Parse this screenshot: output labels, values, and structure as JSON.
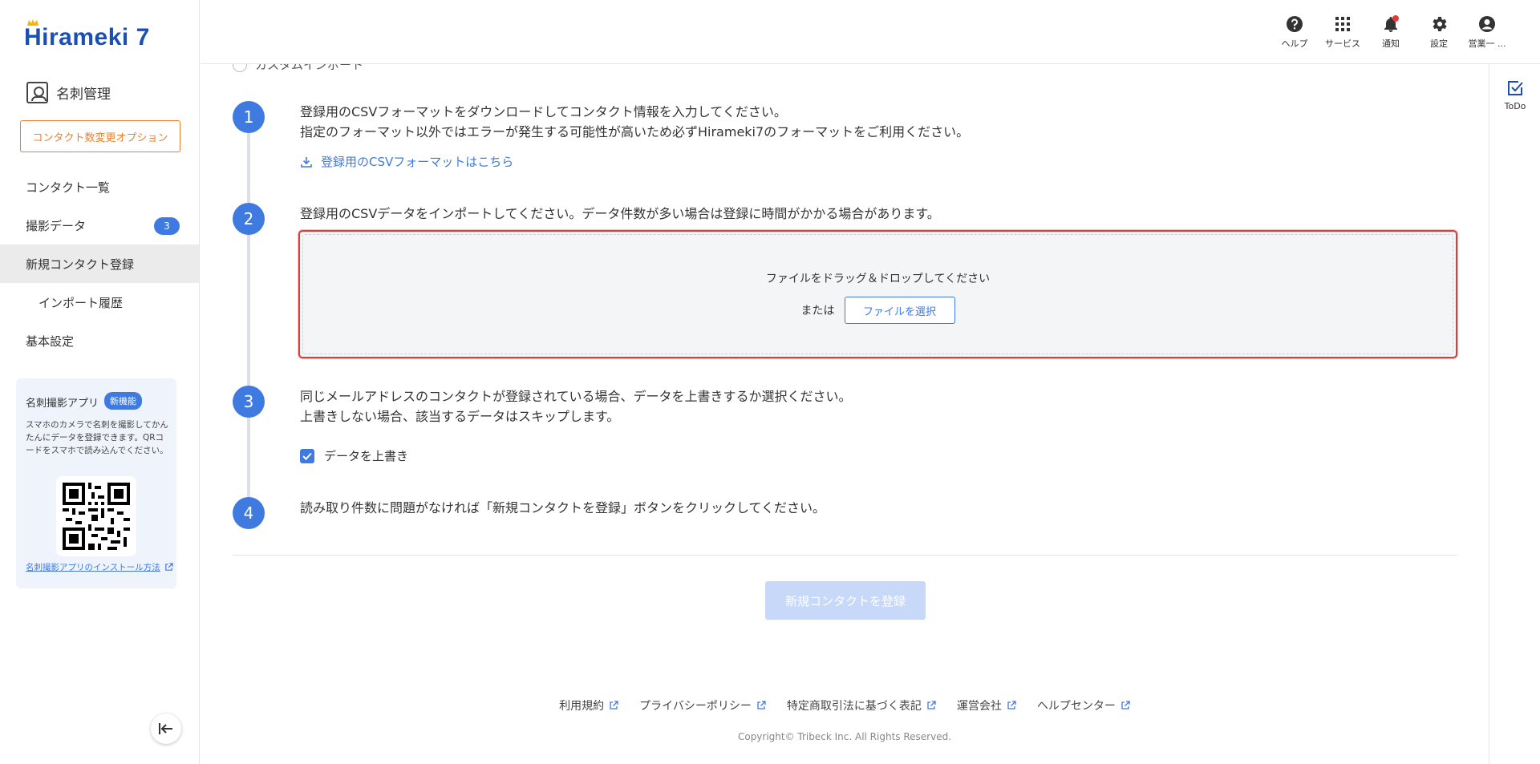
{
  "brand": {
    "logo_text": "Hirameki 7"
  },
  "sidebar": {
    "section_title": "名刺管理",
    "option_button": "コンタクト数変更オプション",
    "items": [
      {
        "label": "コンタクト一覧"
      },
      {
        "label": "撮影データ",
        "badge": "3"
      },
      {
        "label": "新規コンタクト登録"
      },
      {
        "label": "インポート履歴"
      },
      {
        "label": "基本設定"
      }
    ],
    "app_promo": {
      "title": "名刺撮影アプリ",
      "badge": "新機能",
      "description": "スマホのカメラで名刺を撮影してかんたんにデータを登録できます。QRコードをスマホで読み込んでください。",
      "install_link": "名刺撮影アプリのインストール方法"
    }
  },
  "header": {
    "items": [
      {
        "label": "ヘルプ",
        "icon": "help-icon"
      },
      {
        "label": "サービス",
        "icon": "grid-icon"
      },
      {
        "label": "通知",
        "icon": "bell-icon"
      },
      {
        "label": "設定",
        "icon": "gear-icon"
      },
      {
        "label": "営業一 ...",
        "icon": "user-icon"
      }
    ]
  },
  "right_rail": {
    "todo_label": "ToDo"
  },
  "main": {
    "radio_custom_import": "カスタムインポート",
    "steps": [
      {
        "num": "1",
        "line1": "登録用のCSVフォーマットをダウンロードしてコンタクト情報を入力してください。",
        "line2": "指定のフォーマット以外ではエラーが発生する可能性が高いため必ずHirameki7のフォーマットをご利用ください。"
      },
      {
        "num": "2",
        "line1": "登録用のCSVデータをインポートしてください。データ件数が多い場合は登録に時間がかかる場合があります。"
      },
      {
        "num": "3",
        "line1": "同じメールアドレスのコンタクトが登録されている場合、データを上書きするか選択ください。",
        "line2": "上書きしない場合、該当するデータはスキップします。"
      },
      {
        "num": "4",
        "line1": "読み取り件数に問題がなければ「新規コンタクトを登録」ボタンをクリックしてください。"
      }
    ],
    "download_link": "登録用のCSVフォーマットはこちら",
    "dropzone": {
      "instruction": "ファイルをドラッグ＆ドロップしてください",
      "or": "または",
      "select_button": "ファイルを選択"
    },
    "overwrite_checkbox": {
      "label": "データを上書き",
      "checked": true
    },
    "submit_button": "新規コンタクトを登録"
  },
  "footer": {
    "links": [
      "利用規約",
      "プライバシーポリシー",
      "特定商取引法に基づく表記",
      "運営会社",
      "ヘルプセンター"
    ],
    "copyright": "Copyright© Tribeck Inc. All Rights Reserved."
  },
  "colors": {
    "primary": "#3f7ae0",
    "brand": "#1b4fb5",
    "accent_orange": "#f07d2d",
    "error_red": "#e53935",
    "disabled_button": "#c8d8f8"
  }
}
